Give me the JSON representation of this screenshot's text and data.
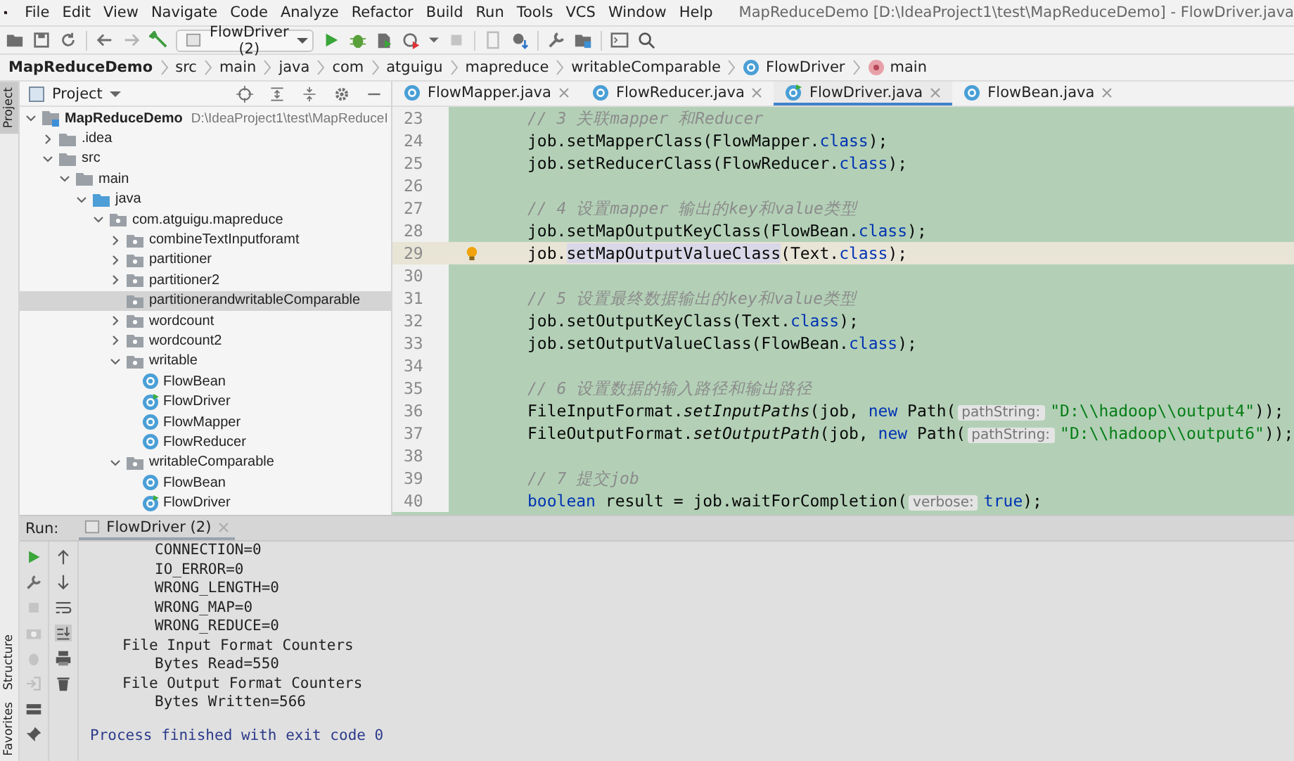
{
  "window": {
    "title": "MapReduceDemo [D:\\IdeaProject1\\test\\MapReduceDemo] - FlowDriver.java"
  },
  "menu": [
    "File",
    "Edit",
    "View",
    "Navigate",
    "Code",
    "Analyze",
    "Refactor",
    "Build",
    "Run",
    "Tools",
    "VCS",
    "Window",
    "Help"
  ],
  "toolbar": {
    "run_configuration": "FlowDriver (2)"
  },
  "breadcrumbs": [
    {
      "label": "MapReduceDemo",
      "kind": "project"
    },
    {
      "label": "src",
      "kind": "folder"
    },
    {
      "label": "main",
      "kind": "folder"
    },
    {
      "label": "java",
      "kind": "folder"
    },
    {
      "label": "com",
      "kind": "folder"
    },
    {
      "label": "atguigu",
      "kind": "folder"
    },
    {
      "label": "mapreduce",
      "kind": "folder"
    },
    {
      "label": "writableComparable",
      "kind": "folder"
    },
    {
      "label": "FlowDriver",
      "kind": "class"
    },
    {
      "label": "main",
      "kind": "method"
    }
  ],
  "side_tabs": {
    "top": [
      {
        "label": "Project",
        "selected": true
      }
    ],
    "bottom": [
      {
        "label": "Structure",
        "selected": false
      },
      {
        "label": "Favorites",
        "selected": false
      }
    ]
  },
  "project_panel": {
    "title": "Project"
  },
  "project_tree": [
    {
      "label": "MapReduceDemo",
      "hint": "D:\\IdeaProject1\\test\\MapReduceI",
      "kind": "module",
      "expanded": true,
      "selected": false,
      "children": [
        {
          "label": ".idea",
          "kind": "folder",
          "expanded": false,
          "selected": false
        },
        {
          "label": "src",
          "kind": "folder",
          "expanded": true,
          "selected": false,
          "children": [
            {
              "label": "main",
              "kind": "folder",
              "expanded": true,
              "selected": false,
              "children": [
                {
                  "label": "java",
                  "kind": "source",
                  "expanded": true,
                  "selected": false,
                  "children": [
                    {
                      "label": "com.atguigu.mapreduce",
                      "kind": "package",
                      "expanded": true,
                      "selected": false,
                      "children": [
                        {
                          "label": "combineTextInputforamt",
                          "kind": "package",
                          "expanded": false,
                          "selected": false
                        },
                        {
                          "label": "partitioner",
                          "kind": "package",
                          "expanded": false,
                          "selected": false
                        },
                        {
                          "label": "partitioner2",
                          "kind": "package",
                          "expanded": false,
                          "selected": false
                        },
                        {
                          "label": "partitionerandwritableComparable",
                          "kind": "package",
                          "selected": true
                        },
                        {
                          "label": "wordcount",
                          "kind": "package",
                          "expanded": false,
                          "selected": false
                        },
                        {
                          "label": "wordcount2",
                          "kind": "package",
                          "expanded": false,
                          "selected": false
                        },
                        {
                          "label": "writable",
                          "kind": "package",
                          "expanded": true,
                          "selected": false,
                          "children": [
                            {
                              "label": "FlowBean",
                              "kind": "class",
                              "selected": false
                            },
                            {
                              "label": "FlowDriver",
                              "kind": "main-class",
                              "selected": false
                            },
                            {
                              "label": "FlowMapper",
                              "kind": "class",
                              "selected": false
                            },
                            {
                              "label": "FlowReducer",
                              "kind": "class",
                              "selected": false
                            }
                          ]
                        },
                        {
                          "label": "writableComparable",
                          "kind": "package",
                          "expanded": true,
                          "selected": false,
                          "children": [
                            {
                              "label": "FlowBean",
                              "kind": "class",
                              "selected": false
                            },
                            {
                              "label": "FlowDriver",
                              "kind": "main-class",
                              "selected": false
                            }
                          ]
                        }
                      ]
                    }
                  ]
                }
              ]
            }
          ]
        }
      ]
    }
  ],
  "tabs": [
    {
      "label": "FlowMapper.java",
      "kind": "class",
      "selected": false
    },
    {
      "label": "FlowReducer.java",
      "kind": "class",
      "selected": false
    },
    {
      "label": "FlowDriver.java",
      "kind": "main-class",
      "selected": true
    },
    {
      "label": "FlowBean.java",
      "kind": "class",
      "selected": false
    }
  ],
  "code_lines": [
    {
      "number": "23",
      "current": false,
      "bulb": false,
      "tokens": [
        {
          "kind": "comment",
          "text": "// 3 关联mapper 和Reducer"
        }
      ]
    },
    {
      "number": "24",
      "current": false,
      "bulb": false,
      "tokens": [
        {
          "kind": "plain",
          "text": "job.setMapperClass(FlowMapper."
        },
        {
          "kind": "keyword",
          "text": "class"
        },
        {
          "kind": "plain",
          "text": ");"
        }
      ]
    },
    {
      "number": "25",
      "current": false,
      "bulb": false,
      "tokens": [
        {
          "kind": "plain",
          "text": "job.setReducerClass(FlowReducer."
        },
        {
          "kind": "keyword",
          "text": "class"
        },
        {
          "kind": "plain",
          "text": ");"
        }
      ]
    },
    {
      "number": "26",
      "current": false,
      "bulb": false
    },
    {
      "number": "27",
      "current": false,
      "bulb": false,
      "tokens": [
        {
          "kind": "comment",
          "text": "// 4 设置mapper 输出的key和value类型"
        }
      ]
    },
    {
      "number": "28",
      "current": false,
      "bulb": false,
      "tokens": [
        {
          "kind": "plain",
          "text": "job.setMapOutputKeyClass(FlowBean."
        },
        {
          "kind": "keyword",
          "text": "class"
        },
        {
          "kind": "plain",
          "text": ");"
        }
      ]
    },
    {
      "number": "29",
      "current": true,
      "bulb": true,
      "tokens": [
        {
          "kind": "plain",
          "text": "job."
        },
        {
          "kind": "usage",
          "text": "setMapOutputValueClass"
        },
        {
          "kind": "plain",
          "text": "(Text."
        },
        {
          "kind": "keyword",
          "text": "class"
        },
        {
          "kind": "plain",
          "text": ");"
        }
      ]
    },
    {
      "number": "30",
      "current": false,
      "bulb": false
    },
    {
      "number": "31",
      "current": false,
      "bulb": false,
      "tokens": [
        {
          "kind": "comment",
          "text": "// 5 设置最终数据输出的key和value类型"
        }
      ]
    },
    {
      "number": "32",
      "current": false,
      "bulb": false,
      "tokens": [
        {
          "kind": "plain",
          "text": "job.setOutputKeyClass(Text."
        },
        {
          "kind": "keyword",
          "text": "class"
        },
        {
          "kind": "plain",
          "text": ");"
        }
      ]
    },
    {
      "number": "33",
      "current": false,
      "bulb": false,
      "tokens": [
        {
          "kind": "plain",
          "text": "job.setOutputValueClass(FlowBean."
        },
        {
          "kind": "keyword",
          "text": "class"
        },
        {
          "kind": "plain",
          "text": ");"
        }
      ]
    },
    {
      "number": "34",
      "current": false,
      "bulb": false
    },
    {
      "number": "35",
      "current": false,
      "bulb": false,
      "tokens": [
        {
          "kind": "comment",
          "text": "// 6 设置数据的输入路径和输出路径"
        }
      ]
    },
    {
      "number": "36",
      "current": false,
      "bulb": false,
      "tokens": [
        {
          "kind": "plain",
          "text": "FileInputFormat."
        },
        {
          "kind": "static",
          "text": "setInputPaths"
        },
        {
          "kind": "plain",
          "text": "(job, "
        },
        {
          "kind": "keyword",
          "text": "new"
        },
        {
          "kind": "plain",
          "text": " Path("
        },
        {
          "kind": "hint",
          "text": "pathString:"
        },
        {
          "kind": "string",
          "text": "\"D:\\\\hadoop\\\\output4\""
        },
        {
          "kind": "plain",
          "text": "));"
        }
      ]
    },
    {
      "number": "37",
      "current": false,
      "bulb": false,
      "tokens": [
        {
          "kind": "plain",
          "text": "FileOutputFormat."
        },
        {
          "kind": "static",
          "text": "setOutputPath"
        },
        {
          "kind": "plain",
          "text": "(job, "
        },
        {
          "kind": "keyword",
          "text": "new"
        },
        {
          "kind": "plain",
          "text": " Path("
        },
        {
          "kind": "hint",
          "text": "pathString:"
        },
        {
          "kind": "string",
          "text": "\"D:\\\\hadoop\\\\output6\""
        },
        {
          "kind": "plain",
          "text": "));"
        }
      ]
    },
    {
      "number": "38",
      "current": false,
      "bulb": false
    },
    {
      "number": "39",
      "current": false,
      "bulb": false,
      "tokens": [
        {
          "kind": "comment",
          "text": "// 7 提交job"
        }
      ]
    },
    {
      "number": "40",
      "current": false,
      "bulb": false,
      "tokens": [
        {
          "kind": "keyword",
          "text": "boolean"
        },
        {
          "kind": "plain",
          "text": " result = job.waitForCompletion("
        },
        {
          "kind": "hint",
          "text": "verbose:"
        },
        {
          "kind": "keyword",
          "text": "true"
        },
        {
          "kind": "plain",
          "text": ");"
        }
      ]
    }
  ],
  "run_panel": {
    "label": "Run:",
    "tab": "FlowDriver (2)",
    "output": [
      {
        "kind": "counter",
        "text": "CONNECTION=0"
      },
      {
        "kind": "counter",
        "text": "IO_ERROR=0"
      },
      {
        "kind": "counter",
        "text": "WRONG_LENGTH=0"
      },
      {
        "kind": "counter",
        "text": "WRONG_MAP=0"
      },
      {
        "kind": "counter",
        "text": "WRONG_REDUCE=0"
      },
      {
        "kind": "group",
        "text": "File Input Format Counters"
      },
      {
        "kind": "counter",
        "text": "Bytes Read=550"
      },
      {
        "kind": "group",
        "text": "File Output Format Counters"
      },
      {
        "kind": "counter",
        "text": "Bytes Written=566"
      },
      {
        "kind": "status",
        "text": "Process finished with exit code 0"
      }
    ]
  }
}
